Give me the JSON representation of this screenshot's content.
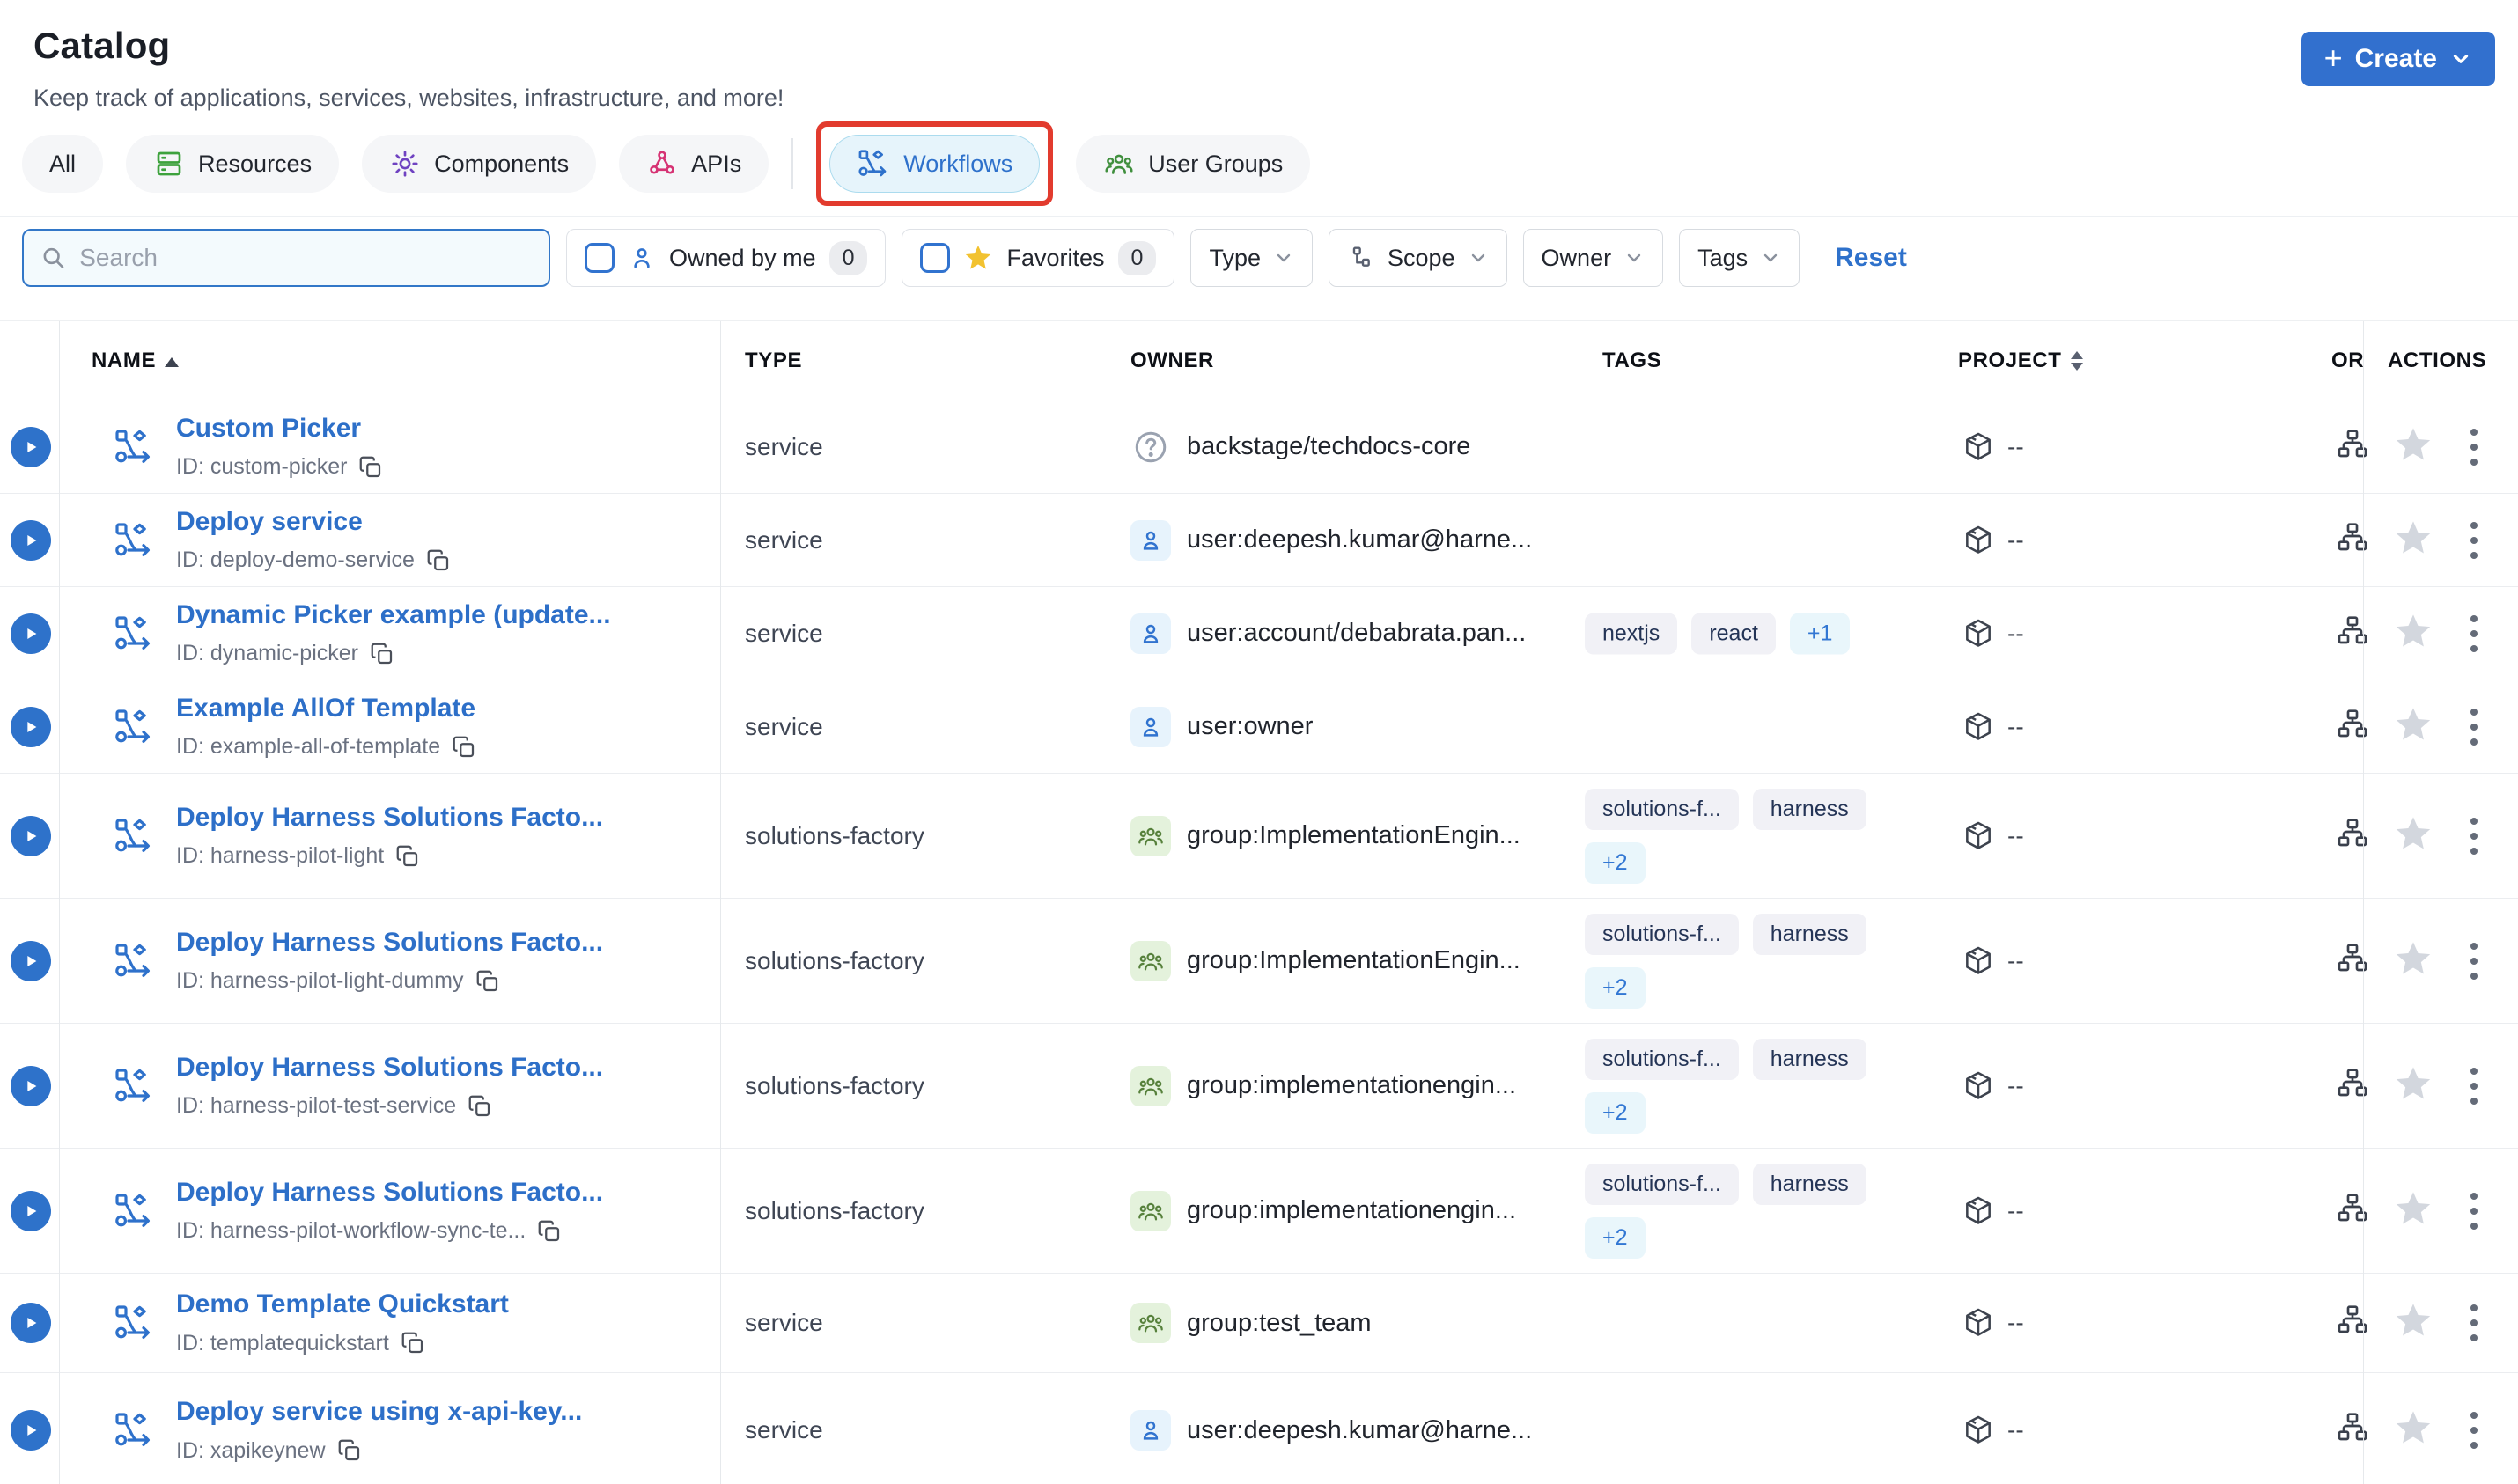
{
  "header": {
    "title": "Catalog",
    "subtitle": "Keep track of applications, services, websites, infrastructure, and more!",
    "create_label": "Create",
    "accent_color": "#3270ce"
  },
  "tabs": [
    {
      "label": "All",
      "icon": "none",
      "selected": false
    },
    {
      "label": "Resources",
      "icon": "server-icon",
      "icon_color": "#3da23d",
      "selected": false
    },
    {
      "label": "Components",
      "icon": "gear-icon",
      "icon_color": "#6f42c1",
      "selected": false
    },
    {
      "label": "APIs",
      "icon": "api-icon",
      "icon_color": "#d63374",
      "selected": false
    },
    {
      "label": "Workflows",
      "icon": "workflow-icon",
      "icon_color": "#2e71cb",
      "selected": true,
      "highlighted_red_box": true
    },
    {
      "label": "User Groups",
      "icon": "user-group-icon",
      "icon_color": "#3f8f3d",
      "selected": false
    }
  ],
  "filters": {
    "search_placeholder": "Search",
    "owned_by_me": {
      "label": "Owned by me",
      "count": "0",
      "checked": false
    },
    "favorites": {
      "label": "Favorites",
      "count": "0",
      "checked": false,
      "star_color": "#f2c230"
    },
    "dropdowns": {
      "type": "Type",
      "scope": "Scope",
      "owner": "Owner",
      "tags": "Tags"
    },
    "reset_label": "Reset"
  },
  "table": {
    "columns": {
      "name": "NAME",
      "type": "TYPE",
      "owner": "OWNER",
      "tags": "TAGS",
      "project": "PROJECT",
      "org": "OR",
      "actions": "ACTIONS"
    },
    "name_sort": "asc",
    "rows": [
      {
        "name": "Custom Picker",
        "id": "ID: custom-picker",
        "type": "service",
        "owner": "backstage/techdocs-core",
        "owner_icon": "question",
        "tags": [],
        "more": "",
        "project": "--"
      },
      {
        "name": "Deploy service",
        "id": "ID: deploy-demo-service",
        "type": "service",
        "owner": "user:deepesh.kumar@harne...",
        "owner_icon": "user",
        "tags": [],
        "more": "",
        "project": "--"
      },
      {
        "name": "Dynamic Picker example (update...",
        "id": "ID: dynamic-picker",
        "type": "service",
        "owner": "user:account/debabrata.pan...",
        "owner_icon": "user",
        "tags": [
          "nextjs",
          "react"
        ],
        "more": "+1",
        "project": "--"
      },
      {
        "name": "Example AllOf Template",
        "id": "ID: example-all-of-template",
        "type": "service",
        "owner": "user:owner",
        "owner_icon": "user",
        "tags": [],
        "more": "",
        "project": "--"
      },
      {
        "name": "Deploy Harness Solutions Facto...",
        "id": "ID: harness-pilot-light",
        "type": "solutions-factory",
        "owner": "group:ImplementationEngin...",
        "owner_icon": "group",
        "tags": [
          "solutions-f...",
          "harness"
        ],
        "more": "+2",
        "project": "--"
      },
      {
        "name": "Deploy Harness Solutions Facto...",
        "id": "ID: harness-pilot-light-dummy",
        "type": "solutions-factory",
        "owner": "group:ImplementationEngin...",
        "owner_icon": "group",
        "tags": [
          "solutions-f...",
          "harness"
        ],
        "more": "+2",
        "project": "--"
      },
      {
        "name": "Deploy Harness Solutions Facto...",
        "id": "ID: harness-pilot-test-service",
        "type": "solutions-factory",
        "owner": "group:implementationengin...",
        "owner_icon": "group",
        "tags": [
          "solutions-f...",
          "harness"
        ],
        "more": "+2",
        "project": "--"
      },
      {
        "name": "Deploy Harness Solutions Facto...",
        "id": "ID: harness-pilot-workflow-sync-te...",
        "type": "solutions-factory",
        "owner": "group:implementationengin...",
        "owner_icon": "group",
        "tags": [
          "solutions-f...",
          "harness"
        ],
        "more": "+2",
        "project": "--"
      },
      {
        "name": "Demo Template Quickstart",
        "id": "ID: templatequickstart",
        "type": "service",
        "owner": "group:test_team",
        "owner_icon": "group",
        "tags": [],
        "more": "",
        "project": "--"
      },
      {
        "name": "Deploy service using x-api-key...",
        "id": "ID: xapikeynew",
        "type": "service",
        "owner": "user:deepesh.kumar@harne...",
        "owner_icon": "user",
        "tags": [],
        "more": "",
        "project": "--"
      }
    ]
  }
}
